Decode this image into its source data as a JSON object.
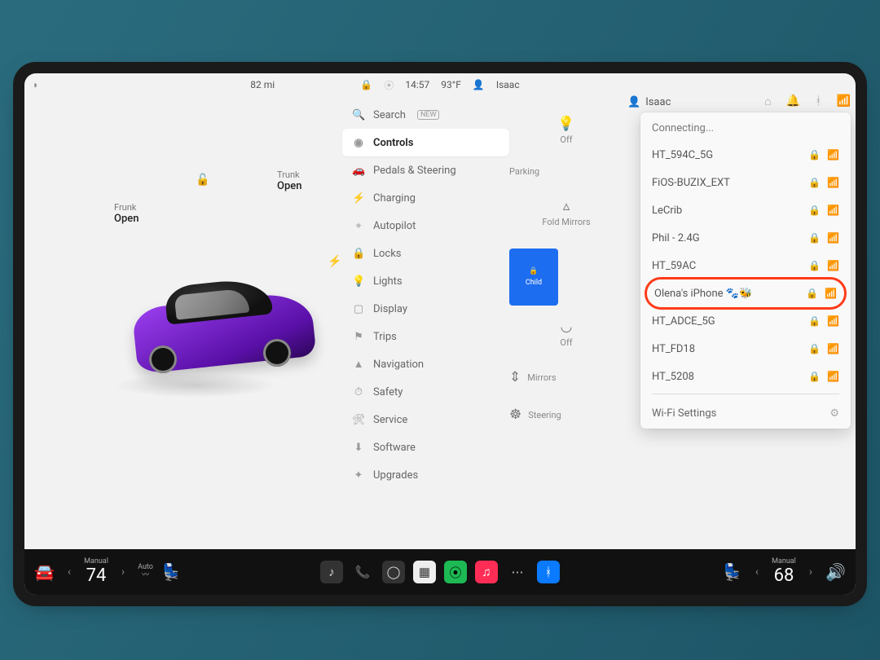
{
  "status": {
    "range_mi": "82 mi",
    "time": "14:57",
    "outside_temp": "93°F",
    "profile": "Isaac"
  },
  "frunk": {
    "label": "Frunk",
    "state": "Open"
  },
  "trunk": {
    "label": "Trunk",
    "state": "Open"
  },
  "settings_menu": {
    "search": "Search",
    "search_badge": "NEW",
    "items": [
      {
        "icon": "◉",
        "label": "Controls",
        "active": true
      },
      {
        "icon": "🚗",
        "label": "Pedals & Steering"
      },
      {
        "icon": "⚡",
        "label": "Charging"
      },
      {
        "icon": "⌖",
        "label": "Autopilot"
      },
      {
        "icon": "🔒",
        "label": "Locks"
      },
      {
        "icon": "💡",
        "label": "Lights"
      },
      {
        "icon": "▢",
        "label": "Display"
      },
      {
        "icon": "⚑",
        "label": "Trips"
      },
      {
        "icon": "▲",
        "label": "Navigation"
      },
      {
        "icon": "⏱",
        "label": "Safety"
      },
      {
        "icon": "🛠",
        "label": "Service"
      },
      {
        "icon": "⬇",
        "label": "Software"
      },
      {
        "icon": "✦",
        "label": "Upgrades"
      }
    ]
  },
  "controls_col": {
    "lights": {
      "icon": "💡",
      "value": "Off"
    },
    "parking": "Parking",
    "fold": {
      "icon": "🪞",
      "label": "Fold Mirrors"
    },
    "child_card": {
      "icon": "🔒",
      "label": "Child"
    },
    "wiper": {
      "icon": "🌀",
      "value": "Off"
    },
    "mirrors": {
      "icon": "↕",
      "label": "Mirrors"
    },
    "steering": {
      "icon": "☸",
      "label": "Steering"
    }
  },
  "profile_chip": "Isaac",
  "wifi": {
    "status": "Connecting...",
    "networks": [
      {
        "name": "HT_594C_5G",
        "locked": true
      },
      {
        "name": "FiOS-BUZIX_EXT",
        "locked": true
      },
      {
        "name": "LeCrib",
        "locked": true
      },
      {
        "name": "Phil - 2.4G",
        "locked": true
      },
      {
        "name": "HT_59AC",
        "locked": true
      },
      {
        "name": "Olena's iPhone 🐾🐝",
        "locked": true,
        "highlight": true
      },
      {
        "name": "HT_ADCE_5G",
        "locked": true
      },
      {
        "name": "HT_FD18",
        "locked": true
      },
      {
        "name": "HT_5208",
        "locked": true
      }
    ],
    "settings_label": "Wi-Fi Settings"
  },
  "dock": {
    "left": {
      "mode": "Manual",
      "temp": "74",
      "auto": "Auto"
    },
    "right": {
      "mode": "Manual",
      "temp": "68"
    }
  }
}
